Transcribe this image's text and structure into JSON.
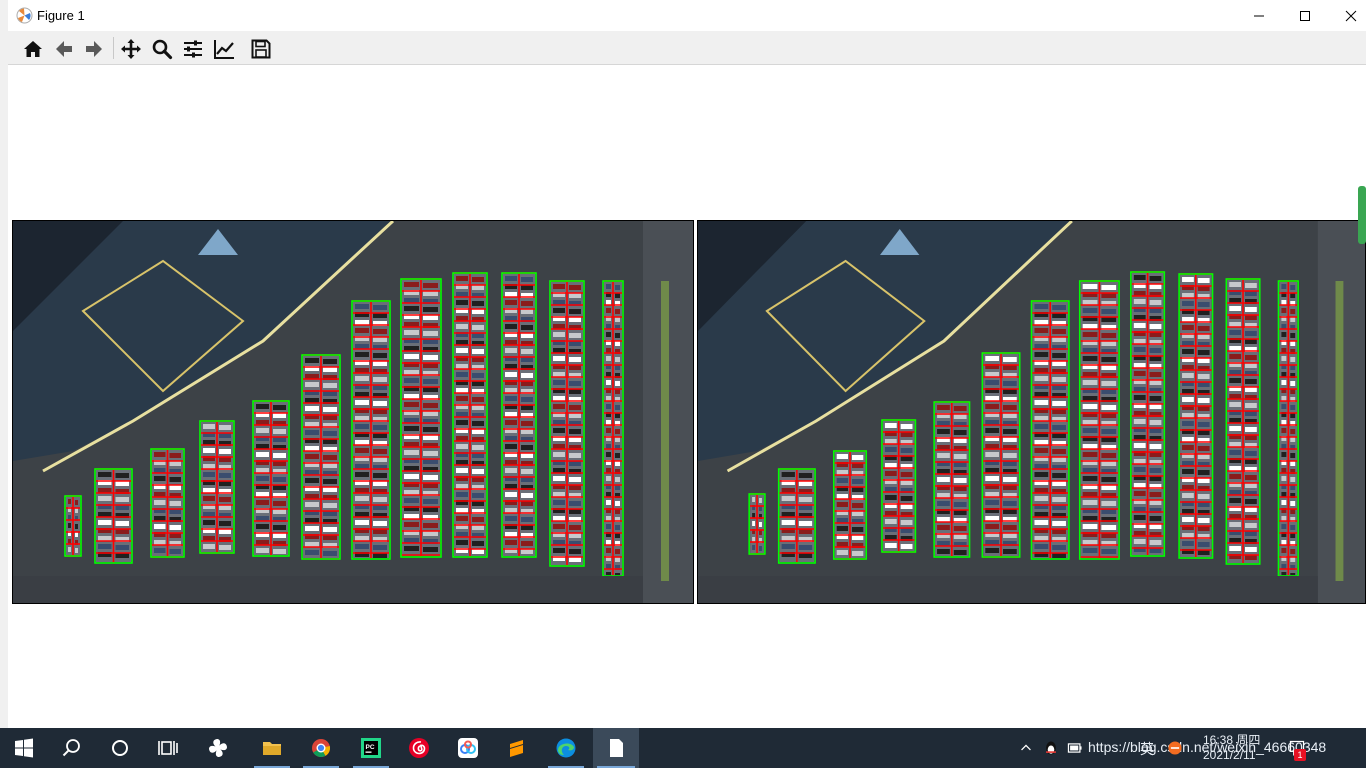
{
  "window": {
    "title": "Figure 1",
    "controls": [
      "minimize",
      "maximize",
      "close"
    ]
  },
  "toolbar": {
    "buttons": [
      {
        "name": "home",
        "icon": "home-icon"
      },
      {
        "name": "back",
        "icon": "arrow-left-icon"
      },
      {
        "name": "forward",
        "icon": "arrow-right-icon"
      },
      {
        "name": "pan",
        "icon": "move-icon"
      },
      {
        "name": "zoom",
        "icon": "magnifier-icon"
      },
      {
        "name": "configure-subplots",
        "icon": "sliders-icon"
      },
      {
        "name": "edit-axes",
        "icon": "line-chart-icon"
      },
      {
        "name": "save",
        "icon": "floppy-disk-icon"
      }
    ]
  },
  "figure": {
    "panels": [
      {
        "name": "left-image",
        "content": "aerial parking lot with spot grid overlay"
      },
      {
        "name": "right-image",
        "content": "aerial parking lot with spot grid overlay"
      }
    ],
    "colors": {
      "spot_lines": "#ff0000",
      "lane_outline": "#00ff00",
      "asphalt": "#3d4247",
      "roof": "#2a3a4a"
    }
  },
  "taskbar": {
    "apps": [
      "windows-start",
      "search",
      "cortana",
      "task-view",
      "pinwheel-app",
      "file-explorer",
      "chrome",
      "pycharm",
      "netease-music",
      "baidu-netdisk",
      "sublime",
      "edge",
      "document"
    ],
    "clock_time": "16:38 周四",
    "clock_date": "2021/2/11",
    "ime": "英",
    "watermark": "https://blog.csdn.net/weixin_46660348",
    "notification_count": "1"
  }
}
